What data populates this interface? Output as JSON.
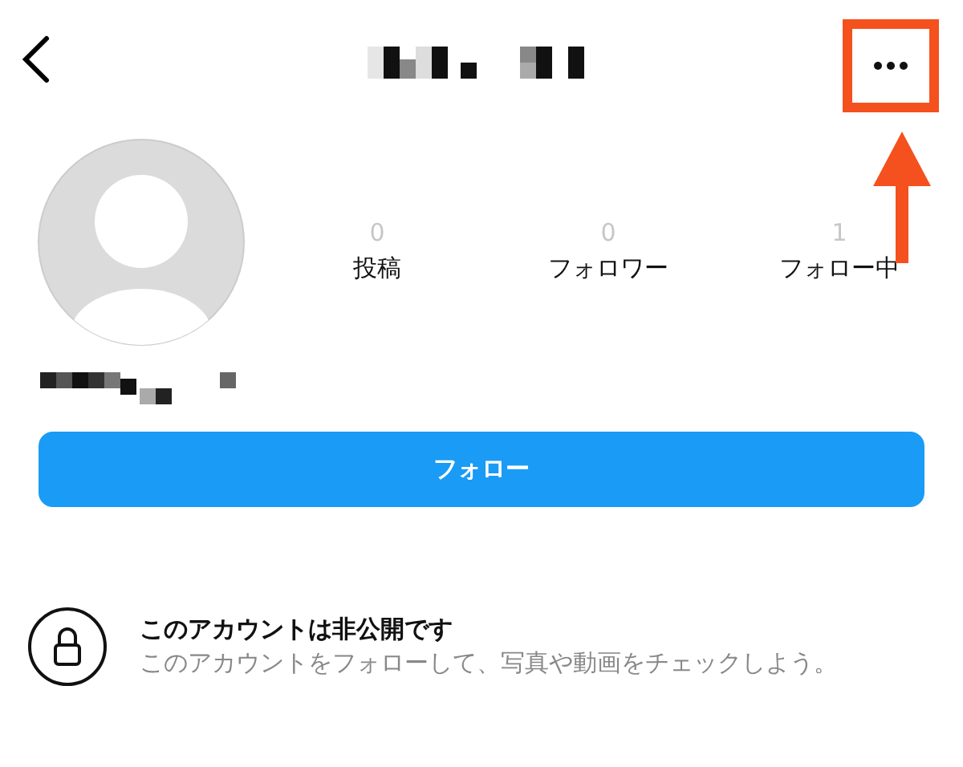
{
  "header": {
    "title_redacted": true,
    "more_highlighted": true
  },
  "stats": [
    {
      "count": "0",
      "label": "投稿"
    },
    {
      "count": "0",
      "label": "フォロワー"
    },
    {
      "count": "1",
      "label": "フォロー中"
    }
  ],
  "name_redacted": true,
  "follow_button": "フォロー",
  "private_notice": {
    "title": "このアカウントは非公開です",
    "text": "このアカウントをフォローして、写真や動画をチェックしよう。"
  }
}
